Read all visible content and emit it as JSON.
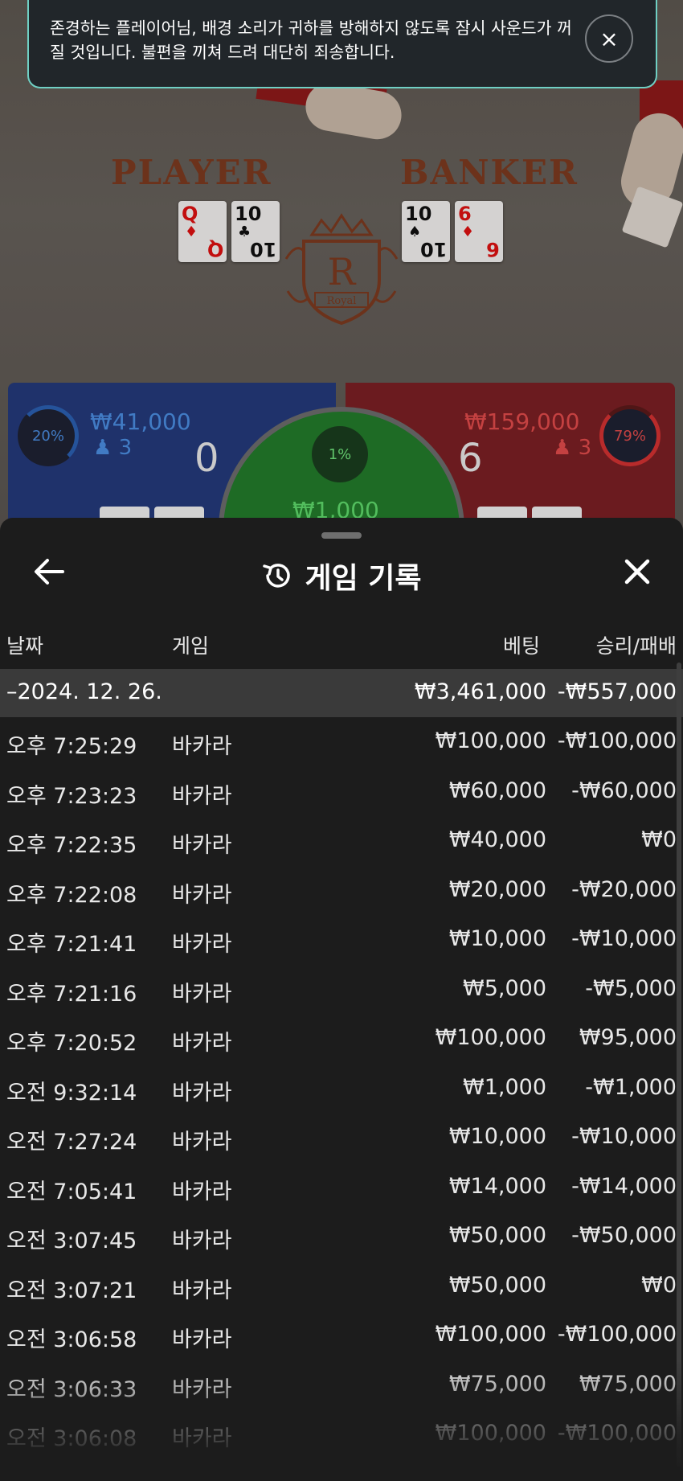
{
  "toast": {
    "message": "존경하는 플레이어님, 배경 소리가 귀하를 방해하지 않도록 잠시 사운드가 꺼질 것입니다. 불편을 끼쳐 드려 대단히 죄송합니다.",
    "close_icon": "×"
  },
  "table": {
    "player_label": "PLAYER",
    "banker_label": "BANKER",
    "crest_letter": "R",
    "crest_text": "Royal",
    "player_cards": [
      {
        "rank": "Q",
        "suit": "♦",
        "color": "red"
      },
      {
        "rank": "10",
        "suit": "♣",
        "color": "black"
      }
    ],
    "banker_cards": [
      {
        "rank": "10",
        "suit": "♠",
        "color": "black"
      },
      {
        "rank": "6",
        "suit": "♦",
        "color": "red"
      }
    ]
  },
  "bets": {
    "player": {
      "percent": "20%",
      "amount": "₩41,000",
      "count": "3",
      "score": "0"
    },
    "banker": {
      "percent": "79%",
      "amount": "₩159,000",
      "count": "3",
      "score": "6"
    },
    "tie": {
      "percent": "1%",
      "amount": "₩1,000"
    }
  },
  "panel": {
    "title": "게임 기록",
    "columns": {
      "date": "날짜",
      "game": "게임",
      "bet": "베팅",
      "win_loss": "승리/패배"
    },
    "date_group": {
      "date": "–2024. 12. 26.",
      "bet_total": "₩3,461,000",
      "win_total": "-₩557,000"
    },
    "rows": [
      {
        "time": "오후 7:25:29",
        "game": "바카라",
        "bet": "₩100,000",
        "win": "-₩100,000"
      },
      {
        "time": "오후 7:23:23",
        "game": "바카라",
        "bet": "₩60,000",
        "win": "-₩60,000"
      },
      {
        "time": "오후 7:22:35",
        "game": "바카라",
        "bet": "₩40,000",
        "win": "₩0"
      },
      {
        "time": "오후 7:22:08",
        "game": "바카라",
        "bet": "₩20,000",
        "win": "-₩20,000"
      },
      {
        "time": "오후 7:21:41",
        "game": "바카라",
        "bet": "₩10,000",
        "win": "-₩10,000"
      },
      {
        "time": "오후 7:21:16",
        "game": "바카라",
        "bet": "₩5,000",
        "win": "-₩5,000"
      },
      {
        "time": "오후 7:20:52",
        "game": "바카라",
        "bet": "₩100,000",
        "win": "₩95,000"
      },
      {
        "time": "오전 9:32:14",
        "game": "바카라",
        "bet": "₩1,000",
        "win": "-₩1,000"
      },
      {
        "time": "오전 7:27:24",
        "game": "바카라",
        "bet": "₩10,000",
        "win": "-₩10,000"
      },
      {
        "time": "오전 7:05:41",
        "game": "바카라",
        "bet": "₩14,000",
        "win": "-₩14,000"
      },
      {
        "time": "오전 3:07:45",
        "game": "바카라",
        "bet": "₩50,000",
        "win": "-₩50,000"
      },
      {
        "time": "오전 3:07:21",
        "game": "바카라",
        "bet": "₩50,000",
        "win": "₩0"
      },
      {
        "time": "오전 3:06:58",
        "game": "바카라",
        "bet": "₩100,000",
        "win": "-₩100,000"
      },
      {
        "time": "오전 3:06:33",
        "game": "바카라",
        "bet": "₩75,000",
        "win": "₩75,000"
      },
      {
        "time": "오전 3:06:08",
        "game": "바카라",
        "bet": "₩100,000",
        "win": "-₩100,000"
      }
    ]
  },
  "icons": {
    "back": "arrow-left-icon",
    "history": "history-icon",
    "close": "close-icon",
    "user": "user-icon"
  },
  "colors": {
    "player_blue": "#243a7a",
    "banker_red": "#7a1f24",
    "tie_green": "#237a2b",
    "toast_border": "#6fd0c4",
    "panel_bg": "#1c1c1c",
    "date_row_bg": "#3a3a3a"
  }
}
